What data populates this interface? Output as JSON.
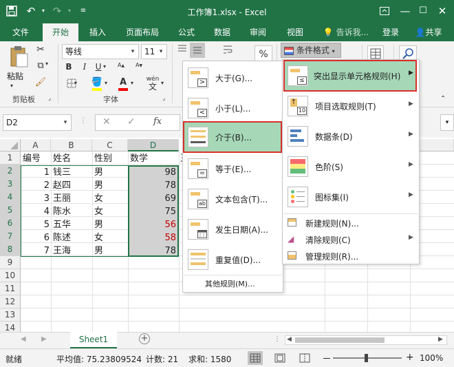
{
  "titlebar": {
    "title": "工作簿1.xlsx - Excel"
  },
  "tabs": [
    "文件",
    "开始",
    "插入",
    "页面布局",
    "公式",
    "数据",
    "审阅",
    "视图"
  ],
  "tellme": "告诉我...",
  "login": "登录",
  "share": "共享",
  "ribbon": {
    "paste": "粘贴",
    "clipboard": "剪贴板",
    "font_name": "等线",
    "font_size": "11",
    "font_group": "字体",
    "bold": "B",
    "italic": "I",
    "underline": "U",
    "wen": "wén",
    "wen2": "文",
    "percent": "%",
    "cond_format": "条件格式"
  },
  "formula": {
    "namebox": "D2",
    "fx": "fx"
  },
  "columns": [
    "A",
    "B",
    "C",
    "D"
  ],
  "headers": [
    "编号",
    "姓名",
    "性别",
    "数学"
  ],
  "rows": [
    {
      "id": "1",
      "name": "钱三",
      "sex": "男",
      "math": "98"
    },
    {
      "id": "2",
      "name": "赵四",
      "sex": "男",
      "math": "78"
    },
    {
      "id": "3",
      "name": "王丽",
      "sex": "女",
      "math": "69"
    },
    {
      "id": "4",
      "name": "陈水",
      "sex": "女",
      "math": "75"
    },
    {
      "id": "5",
      "name": "五华",
      "sex": "男",
      "math": "56"
    },
    {
      "id": "6",
      "name": "陈述",
      "sex": "女",
      "math": "58"
    },
    {
      "id": "7",
      "name": "王海",
      "sex": "男",
      "math": "78"
    }
  ],
  "row_numbers": [
    "1",
    "2",
    "3",
    "4",
    "5",
    "6",
    "7",
    "8",
    "9",
    "10",
    "11",
    "12",
    "13",
    "14"
  ],
  "e1": "王",
  "menu_left": {
    "items": [
      "大于(G)...",
      "小于(L)...",
      "介于(B)...",
      "等于(E)...",
      "文本包含(T)...",
      "发生日期(A)...",
      "重复值(D)..."
    ],
    "other": "其他规则(M)...",
    "icon_texts": [
      ">",
      "<",
      "",
      "=",
      "ab",
      "",
      ""
    ]
  },
  "menu_right": {
    "items": [
      "突出显示单元格规则(H)",
      "项目选取规则(T)",
      "数据条(D)",
      "色阶(S)",
      "图标集(I)"
    ],
    "simple": [
      "新建规则(N)...",
      "清除规则(C)",
      "管理规则(R)..."
    ],
    "icon_texts": [
      "≤",
      "10",
      "",
      "",
      ""
    ]
  },
  "sheet_tab": "Sheet1",
  "status": {
    "ready": "就绪",
    "average": "平均值: 75.23809524",
    "count": "计数: 21",
    "sum": "求和: 1580",
    "zoom": "100%",
    "minus": "－",
    "plus": "+"
  },
  "colors": {
    "brand": "#217346",
    "highlight": "#a6d8b8",
    "red_outline": "#d9302c",
    "red_text": "#c00000"
  }
}
